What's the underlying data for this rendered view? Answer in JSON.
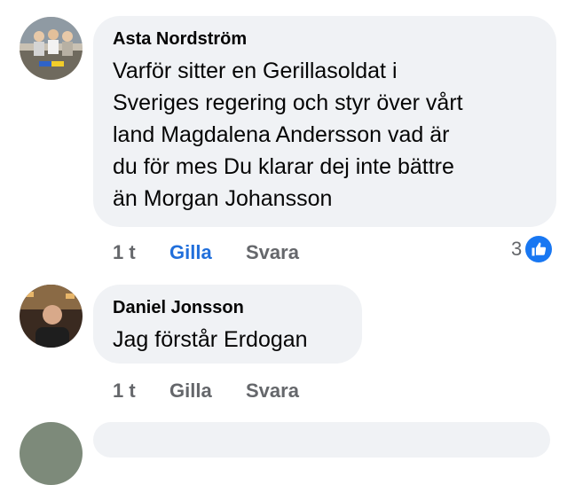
{
  "comments": [
    {
      "author": "Asta Nordström",
      "text": "Varför sitter en Gerillasoldat i Sveriges regering och styr över vårt land Magdalena Andersson  vad är du för mes Du klarar dej inte bättre än Morgan Johansson",
      "lines": [
        "Varför sitter en Gerillasoldat i",
        "Sveriges regering och styr över vårt",
        "land Magdalena Andersson  vad är",
        "du för mes Du klarar dej inte bättre",
        "än Morgan Johansson"
      ],
      "time": "1 t",
      "like_label": "Gilla",
      "like_active": true,
      "reply_label": "Svara",
      "reaction_count": "3",
      "reaction_icon": "like-icon"
    },
    {
      "author": "Daniel Jonsson",
      "text": "Jag förstår Erdogan",
      "time": "1 t",
      "like_label": "Gilla",
      "like_active": false,
      "reply_label": "Svara"
    }
  ],
  "colors": {
    "bubble": "#f0f2f5",
    "like_active": "#216fdb",
    "muted": "#65676b",
    "badge": "#1877f2"
  }
}
